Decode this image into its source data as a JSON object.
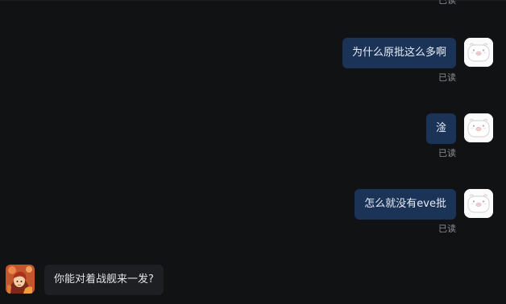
{
  "messages": [
    {
      "sender": "self",
      "text": "为什么原批这么多啊",
      "status": "已读"
    },
    {
      "sender": "self",
      "text": "淦",
      "status": "已读"
    },
    {
      "sender": "self",
      "text": "怎么就没有eve批",
      "status": "已读"
    },
    {
      "sender": "other",
      "text": "你能对着战舰来一发?"
    }
  ],
  "top_status": "已读",
  "colors": {
    "background": "#111214",
    "outgoing_bubble": "#1c3358",
    "incoming_bubble": "#1d1f23",
    "read_receipt": "#8a8d93"
  },
  "icons": {
    "self_avatar": "white-pig-avatar-icon",
    "other_avatar": "anime-character-avatar-icon"
  }
}
